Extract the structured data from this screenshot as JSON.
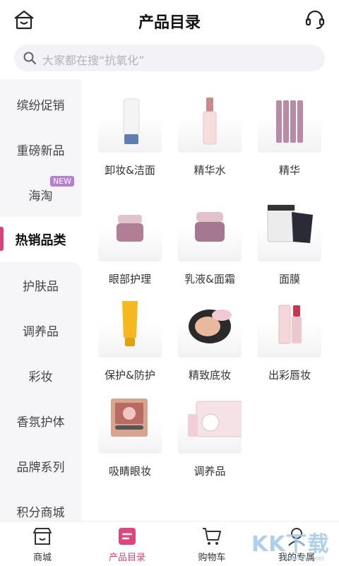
{
  "header": {
    "title": "产品目录"
  },
  "search": {
    "placeholder": "大家都在搜“抗氧化”"
  },
  "sidebar": {
    "items": [
      {
        "label": "缤纷促销"
      },
      {
        "label": "重磅新品"
      },
      {
        "label": "海淘",
        "badge": "NEW"
      },
      {
        "label": "热销品类",
        "active": true
      },
      {
        "label": "护肤品"
      },
      {
        "label": "调养品"
      },
      {
        "label": "彩妆"
      },
      {
        "label": "香氛护体"
      },
      {
        "label": "品牌系列"
      },
      {
        "label": "积分商城"
      }
    ]
  },
  "products": [
    {
      "label": "卸妆&洁面",
      "icon": "cleanser-tube-icon"
    },
    {
      "label": "精华水",
      "icon": "essence-bottle-icon"
    },
    {
      "label": "精华",
      "icon": "serum-vials-icon"
    },
    {
      "label": "眼部护理",
      "icon": "eye-cream-jar-icon"
    },
    {
      "label": "乳液&面霜",
      "icon": "cream-jar-icon"
    },
    {
      "label": "面膜",
      "icon": "face-mask-icon"
    },
    {
      "label": "保护&防护",
      "icon": "sunscreen-tube-icon"
    },
    {
      "label": "精致底妆",
      "icon": "cushion-compact-icon"
    },
    {
      "label": "出彩唇妆",
      "icon": "lipstick-icon"
    },
    {
      "label": "吸睛眼妆",
      "icon": "eyeshadow-palette-icon"
    },
    {
      "label": "调养品",
      "icon": "supplement-box-icon"
    }
  ],
  "tabbar": {
    "items": [
      {
        "label": "商城",
        "icon": "store-icon"
      },
      {
        "label": "产品目录",
        "icon": "catalog-icon",
        "active": true
      },
      {
        "label": "购物车",
        "icon": "cart-icon"
      },
      {
        "label": "我的专属",
        "icon": "profile-icon"
      }
    ]
  },
  "watermark": {
    "text": "KK下载",
    "url": "www.kkx.net"
  },
  "colors": {
    "accent": "#d9437a",
    "sidebar_bg": "#f6f5f8",
    "badge": "#b77fd3"
  }
}
